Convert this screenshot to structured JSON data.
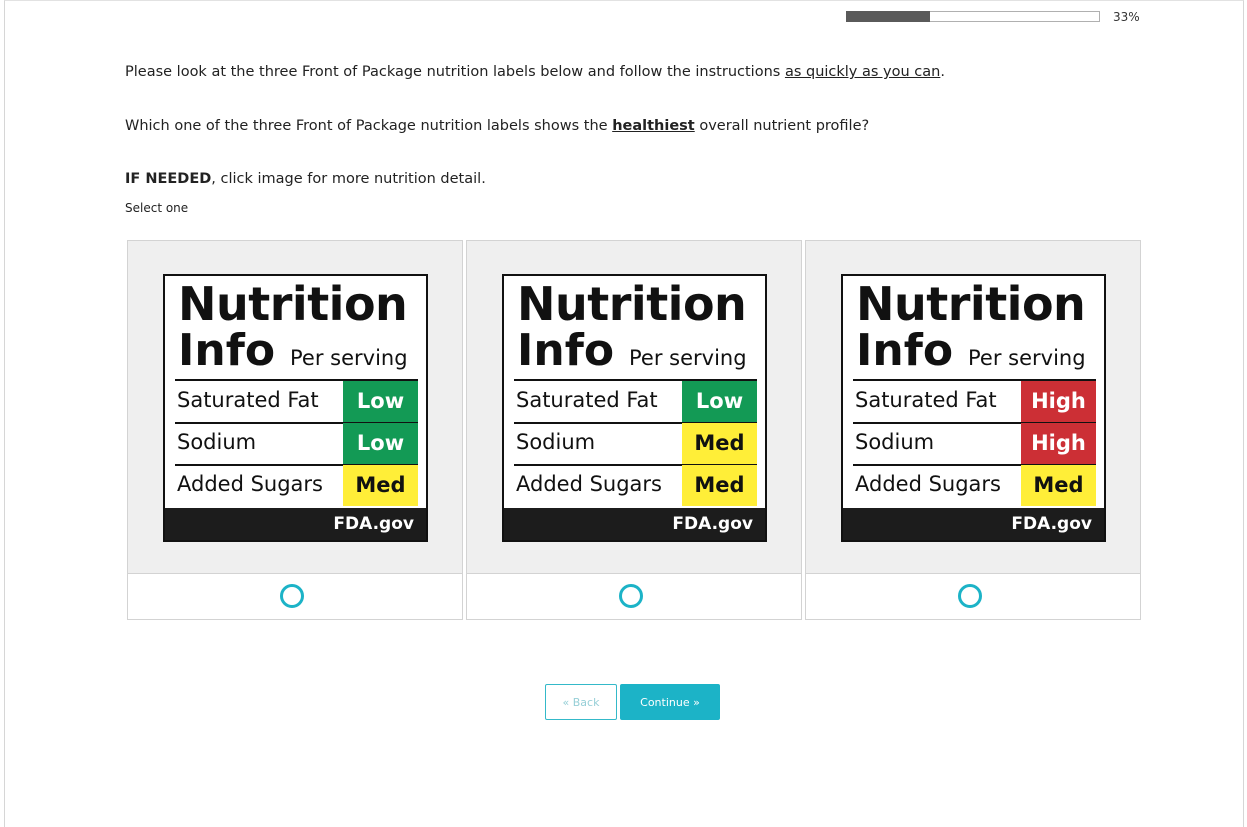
{
  "progress": {
    "percent_text": "33%",
    "fraction": 0.33
  },
  "question": {
    "line1_pre": "Please look at the three Front of Package nutrition labels below and follow the instructions ",
    "line1_underline": "as quickly as you can",
    "line1_post": ".",
    "line2_pre": "Which one of the three Front of Package nutrition labels shows the ",
    "line2_bold": "healthiest",
    "line2_post": " overall nutrient profile?",
    "line3_bold": "IF NEEDED",
    "line3_post": ", click image for more nutrition detail.",
    "select_hint": "Select one"
  },
  "label_common": {
    "title_line1": "Nutrition",
    "title_line2": "Info",
    "per_serving": "Per serving",
    "row1_name": "Saturated Fat",
    "row2_name": "Sodium",
    "row3_name": "Added Sugars",
    "footer": "FDA.gov"
  },
  "options": [
    {
      "sat_fat": "Low",
      "sodium": "Low",
      "sugars": "Med"
    },
    {
      "sat_fat": "Low",
      "sodium": "Med",
      "sugars": "Med"
    },
    {
      "sat_fat": "High",
      "sodium": "High",
      "sugars": "Med"
    }
  ],
  "colors": {
    "low": "#139a55",
    "med": "#ffee38",
    "high": "#cc2f35",
    "accent": "#1cb3c7"
  },
  "buttons": {
    "back": "« Back",
    "continue": "Continue »"
  }
}
